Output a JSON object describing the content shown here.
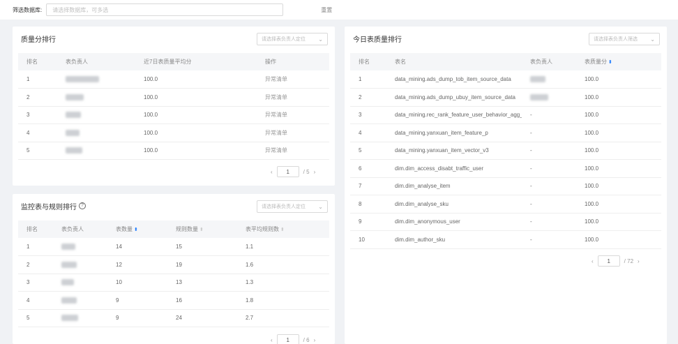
{
  "filter": {
    "label": "筛选数据库:",
    "placeholder": "请选择数据库，可多选",
    "reset_label": "重置"
  },
  "score_rank": {
    "title": "质量分排行",
    "select_placeholder": "请选择表负责人定位",
    "headers": [
      "排名",
      "表负责人",
      "近7日表质量平均分",
      "操作"
    ],
    "rows": [
      {
        "rank": "1",
        "owner_width": 48,
        "score": "100.0",
        "action": "异常清单"
      },
      {
        "rank": "2",
        "owner_width": 26,
        "score": "100.0",
        "action": "异常清单"
      },
      {
        "rank": "3",
        "owner_width": 22,
        "score": "100.0",
        "action": "异常清单"
      },
      {
        "rank": "4",
        "owner_width": 20,
        "score": "100.0",
        "action": "异常清单"
      },
      {
        "rank": "5",
        "owner_width": 24,
        "score": "100.0",
        "action": "异常清单"
      }
    ],
    "pager": {
      "current": "1",
      "total": "/ 5"
    }
  },
  "rule_rank": {
    "title": "监控表与规则排行",
    "select_placeholder": "请选择表负责人定位",
    "headers": [
      "排名",
      "表负责人",
      "表数量",
      "规则数量",
      "表平均规则数"
    ],
    "rows": [
      {
        "rank": "1",
        "owner_width": 20,
        "tables": "14",
        "rules": "15",
        "avg": "1.1"
      },
      {
        "rank": "2",
        "owner_width": 22,
        "tables": "12",
        "rules": "19",
        "avg": "1.6"
      },
      {
        "rank": "3",
        "owner_width": 18,
        "tables": "10",
        "rules": "13",
        "avg": "1.3"
      },
      {
        "rank": "4",
        "owner_width": 22,
        "tables": "9",
        "rules": "16",
        "avg": "1.8"
      },
      {
        "rank": "5",
        "owner_width": 24,
        "tables": "9",
        "rules": "24",
        "avg": "2.7"
      }
    ],
    "pager": {
      "current": "1",
      "total": "/ 6"
    }
  },
  "today_rank": {
    "title": "今日表质量排行",
    "select_placeholder": "请选择表负责人筛选",
    "headers": [
      "排名",
      "表名",
      "表负责人",
      "表质量分"
    ],
    "rows": [
      {
        "rank": "1",
        "table": "data_mining.ads_dump_tob_item_source_data",
        "owner": "",
        "owner_width": 22,
        "score": "100.0"
      },
      {
        "rank": "2",
        "table": "data_mining.ads_dump_ubuy_item_source_data",
        "owner": "",
        "owner_width": 26,
        "score": "100.0"
      },
      {
        "rank": "3",
        "table": "data_mining.rec_rank_feature_user_behavior_agg_i",
        "owner": "-",
        "owner_width": 0,
        "score": "100.0"
      },
      {
        "rank": "4",
        "table": "data_mining.yanxuan_item_feature_p",
        "owner": "-",
        "owner_width": 0,
        "score": "100.0"
      },
      {
        "rank": "5",
        "table": "data_mining.yanxuan_item_vector_v3",
        "owner": "-",
        "owner_width": 0,
        "score": "100.0"
      },
      {
        "rank": "6",
        "table": "dim.dim_access_disabt_traffic_user",
        "owner": "-",
        "owner_width": 0,
        "score": "100.0"
      },
      {
        "rank": "7",
        "table": "dim.dim_analyse_item",
        "owner": "-",
        "owner_width": 0,
        "score": "100.0"
      },
      {
        "rank": "8",
        "table": "dim.dim_analyse_sku",
        "owner": "-",
        "owner_width": 0,
        "score": "100.0"
      },
      {
        "rank": "9",
        "table": "dim.dim_anonymous_user",
        "owner": "-",
        "owner_width": 0,
        "score": "100.0"
      },
      {
        "rank": "10",
        "table": "dim.dim_author_sku",
        "owner": "-",
        "owner_width": 0,
        "score": "100.0"
      }
    ],
    "pager": {
      "current": "1",
      "total": "/ 72"
    }
  },
  "colors": {
    "accent": "#1677ff",
    "background": "#f0f2f5",
    "header_row": "#f5f6f8"
  }
}
